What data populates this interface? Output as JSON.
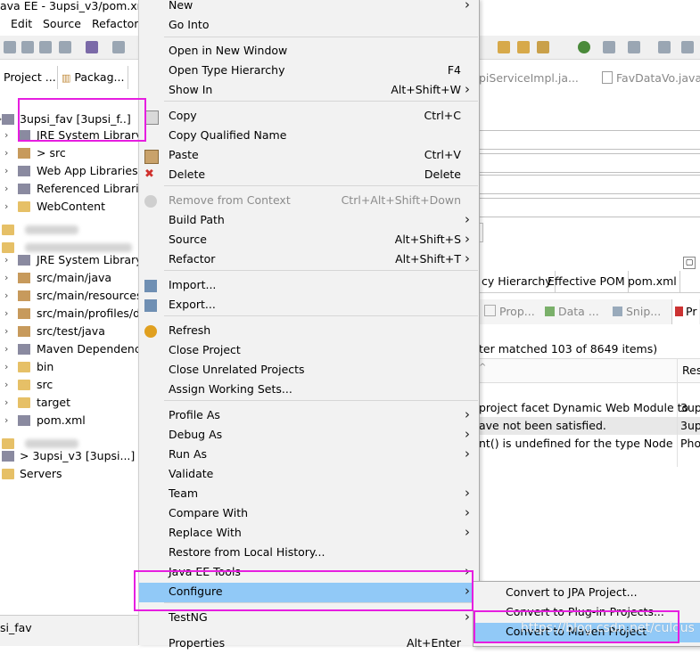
{
  "window": {
    "title": "ava EE - 3upsi_v3/pom.xm"
  },
  "menubar": {
    "edit": "Edit",
    "source": "Source",
    "refactor": "Refactor"
  },
  "left_tabs": {
    "project": "Project ...",
    "package": "Packag..."
  },
  "tree": {
    "items": [
      {
        "label": "3upsi_fav  [3upsi_f..]",
        "icon": "project-icon"
      },
      {
        "label": "JRE System Library",
        "icon": "library-icon"
      },
      {
        "label": "> src",
        "icon": "package-icon"
      },
      {
        "label": "Web App Libraries",
        "icon": "library-icon"
      },
      {
        "label": "Referenced Librarie",
        "icon": "library-icon"
      },
      {
        "label": "WebContent",
        "icon": "folder-icon"
      },
      {
        "label": "JRE System Library",
        "icon": "library-icon"
      },
      {
        "label": "src/main/java",
        "icon": "package-icon"
      },
      {
        "label": "src/main/resources",
        "icon": "package-icon"
      },
      {
        "label": "src/main/profiles/d",
        "icon": "package-icon"
      },
      {
        "label": "src/test/java",
        "icon": "package-icon"
      },
      {
        "label": "Maven Dependencie",
        "icon": "library-icon"
      },
      {
        "label": "bin",
        "icon": "folder-icon"
      },
      {
        "label": "src",
        "icon": "folder-icon"
      },
      {
        "label": "target",
        "icon": "folder-icon"
      },
      {
        "label": "pom.xml",
        "icon": "xml-file-icon"
      },
      {
        "label": "> 3upsi_v3 [3upsi...]",
        "icon": "project-icon"
      },
      {
        "label": "Servers",
        "icon": "folder-icon"
      }
    ],
    "bottom_label": "si_fav"
  },
  "editor_tabs": {
    "tab1": "piServiceImpl.ja...",
    "tab2": "FavDataVo.java"
  },
  "pom_tabs": [
    "cy Hierarchy",
    "Effective POM",
    "pom.xml"
  ],
  "view_tabs": [
    "Prop...",
    "Data ...",
    "Snip...",
    "Pr"
  ],
  "problems": {
    "summary": "ter matched 103 of 8649 items)",
    "col_resource": "Res",
    "rows": [
      {
        "desc": "project facet Dynamic Web Module to",
        "res": "3up"
      },
      {
        "desc": "ave not been satisfied.",
        "res": "3up"
      },
      {
        "desc": "nt() is undefined for the type Node",
        "res": "Pho"
      }
    ]
  },
  "context_menu": {
    "items": [
      {
        "label": "New",
        "accel": "",
        "submenu": true,
        "icon": ""
      },
      {
        "label": "Go Into",
        "accel": "",
        "submenu": false,
        "icon": ""
      },
      {
        "label": "Open in New Window",
        "accel": "",
        "submenu": false,
        "icon": ""
      },
      {
        "label": "Open Type Hierarchy",
        "accel": "F4",
        "submenu": false,
        "icon": ""
      },
      {
        "label": "Show In",
        "accel": "Alt+Shift+W",
        "submenu": true,
        "icon": ""
      },
      {
        "label": "Copy",
        "accel": "Ctrl+C",
        "submenu": false,
        "icon": "copy-icon"
      },
      {
        "label": "Copy Qualified Name",
        "accel": "",
        "submenu": false,
        "icon": ""
      },
      {
        "label": "Paste",
        "accel": "Ctrl+V",
        "submenu": false,
        "icon": "paste-icon"
      },
      {
        "label": "Delete",
        "accel": "Delete",
        "submenu": false,
        "icon": "delete-icon"
      },
      {
        "label": "Remove from Context",
        "accel": "Ctrl+Alt+Shift+Down",
        "submenu": false,
        "icon": "remove-context-icon",
        "disabled": true
      },
      {
        "label": "Build Path",
        "accel": "",
        "submenu": true,
        "icon": ""
      },
      {
        "label": "Source",
        "accel": "Alt+Shift+S",
        "submenu": true,
        "icon": ""
      },
      {
        "label": "Refactor",
        "accel": "Alt+Shift+T",
        "submenu": true,
        "icon": ""
      },
      {
        "label": "Import...",
        "accel": "",
        "submenu": false,
        "icon": "import-icon"
      },
      {
        "label": "Export...",
        "accel": "",
        "submenu": false,
        "icon": "export-icon"
      },
      {
        "label": "Refresh",
        "accel": "",
        "submenu": false,
        "icon": "refresh-icon"
      },
      {
        "label": "Close Project",
        "accel": "",
        "submenu": false,
        "icon": ""
      },
      {
        "label": "Close Unrelated Projects",
        "accel": "",
        "submenu": false,
        "icon": ""
      },
      {
        "label": "Assign Working Sets...",
        "accel": "",
        "submenu": false,
        "icon": ""
      },
      {
        "label": "Profile As",
        "accel": "",
        "submenu": true,
        "icon": ""
      },
      {
        "label": "Debug As",
        "accel": "",
        "submenu": true,
        "icon": ""
      },
      {
        "label": "Run As",
        "accel": "",
        "submenu": true,
        "icon": ""
      },
      {
        "label": "Validate",
        "accel": "",
        "submenu": false,
        "icon": ""
      },
      {
        "label": "Team",
        "accel": "",
        "submenu": true,
        "icon": ""
      },
      {
        "label": "Compare With",
        "accel": "",
        "submenu": true,
        "icon": ""
      },
      {
        "label": "Replace With",
        "accel": "",
        "submenu": true,
        "icon": ""
      },
      {
        "label": "Restore from Local History...",
        "accel": "",
        "submenu": false,
        "icon": ""
      },
      {
        "label": "Java EE Tools",
        "accel": "",
        "submenu": true,
        "icon": ""
      },
      {
        "label": "Configure",
        "accel": "",
        "submenu": true,
        "icon": "",
        "selected": true
      },
      {
        "label": "TestNG",
        "accel": "",
        "submenu": true,
        "icon": ""
      },
      {
        "label": "Properties",
        "accel": "Alt+Enter",
        "submenu": false,
        "icon": ""
      }
    ]
  },
  "configure_submenu": {
    "items": [
      {
        "label": "Convert to JPA Project..."
      },
      {
        "label": "Convert to Plug-in Projects..."
      },
      {
        "label": "Convert to Maven Project",
        "selected": true
      }
    ]
  },
  "watermark": "https://blog.csdn.net/culous",
  "colors": {
    "highlight_box": "#e61ee0",
    "menu_selection": "#91c9f7"
  }
}
